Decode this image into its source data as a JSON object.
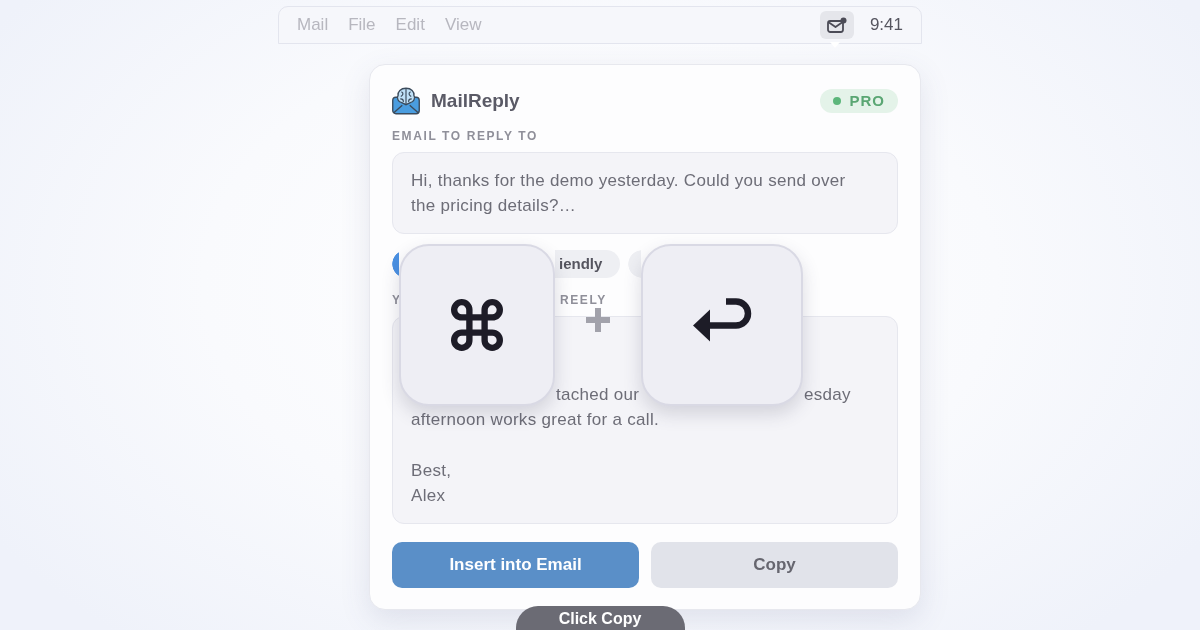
{
  "menu_bar": {
    "items": [
      "Mail",
      "File",
      "Edit",
      "View"
    ],
    "status_icon": {
      "active": true
    },
    "clock": "9:41"
  },
  "app": {
    "name": "MailReply",
    "badge": "PRO"
  },
  "email": {
    "label": "EMAIL TO REPLY TO",
    "text": "Hi, thanks for the demo yesterday. Could you send over the pricing details?…"
  },
  "tones": [
    {
      "selected": true
    },
    {
      "label": "iendly",
      "selected": false
    },
    {
      "selected": false
    }
  ],
  "reply": {
    "label": [
      "Y",
      "REELY"
    ],
    "paragraphs": [
      {
        "lines": [
          [
            "tached our",
            "esday"
          ],
          [
            "afternoon works great for a call."
          ]
        ]
      },
      {
        "lines": [
          [
            "Best,"
          ],
          [
            "Alex"
          ]
        ]
      }
    ]
  },
  "shortcut": {
    "keys": [
      {
        "kind": "command"
      },
      {
        "kind": "return"
      }
    ]
  },
  "buttons": [
    {
      "kind": "primary",
      "label": "Insert into Email"
    },
    {
      "kind": "secondary",
      "label": "Copy"
    }
  ],
  "tooltip": "Click Copy"
}
